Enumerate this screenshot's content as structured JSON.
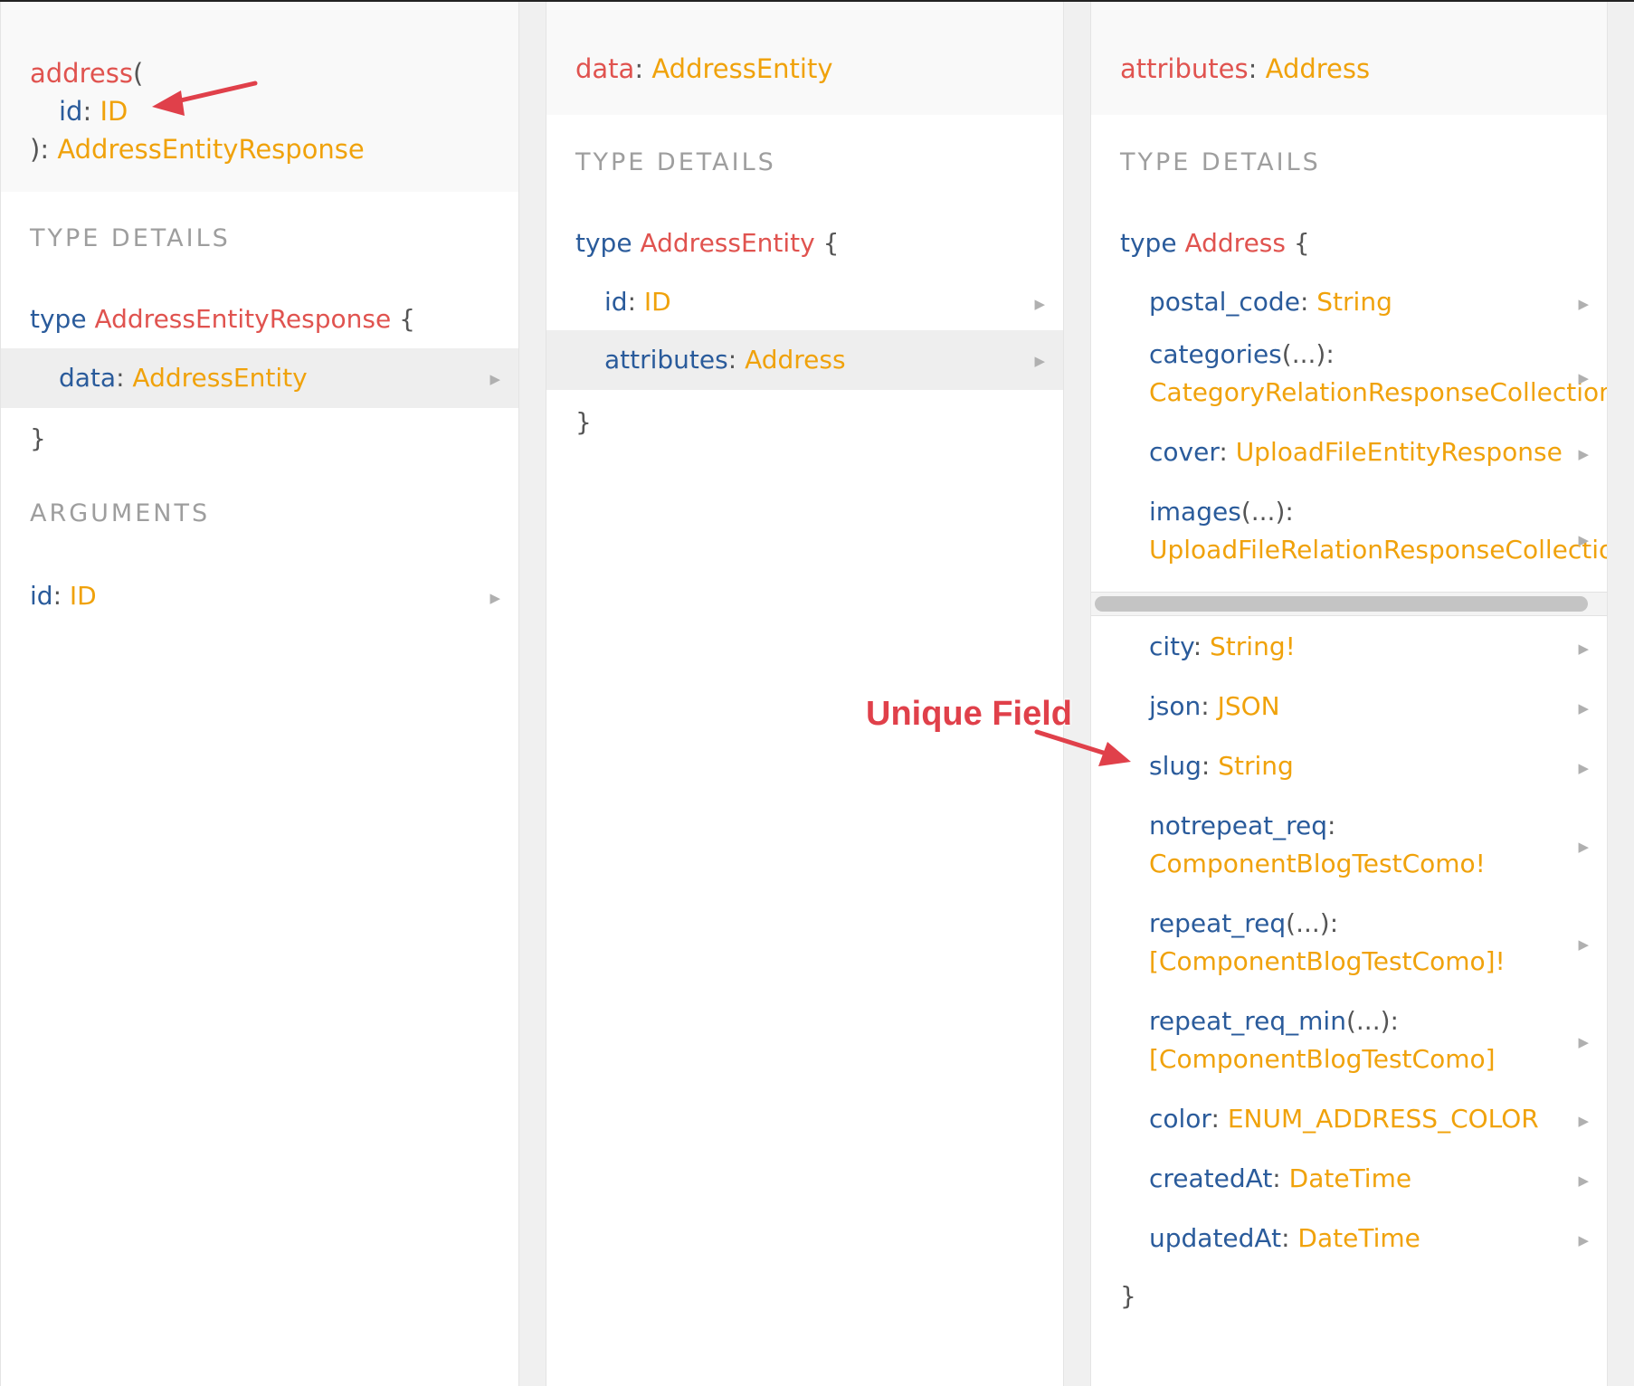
{
  "column1": {
    "header": {
      "name": "address",
      "open_paren": "(",
      "arg_name": "id",
      "arg_type": "ID",
      "close": "): ",
      "return_type": "AddressEntityResponse"
    },
    "type_details_title": "TYPE DETAILS",
    "type_keyword": "type",
    "type_name": "AddressEntityResponse",
    "open_brace": "{",
    "fields": [
      {
        "name": "data",
        "type": "AddressEntity"
      }
    ],
    "close_brace": "}",
    "arguments_title": "ARGUMENTS",
    "arguments": [
      {
        "name": "id",
        "type": "ID"
      }
    ]
  },
  "column2": {
    "header": {
      "name": "data",
      "type": "AddressEntity"
    },
    "type_details_title": "TYPE DETAILS",
    "type_keyword": "type",
    "type_name": "AddressEntity",
    "open_brace": "{",
    "fields": [
      {
        "name": "id",
        "type": "ID"
      },
      {
        "name": "attributes",
        "type": "Address"
      }
    ],
    "close_brace": "}"
  },
  "column3": {
    "header": {
      "name": "attributes",
      "type": "Address"
    },
    "type_details_title": "TYPE DETAILS",
    "type_keyword": "type",
    "type_name": "Address",
    "open_brace": "{",
    "fields": [
      {
        "name": "postal_code",
        "suffix": ": ",
        "type": "String"
      },
      {
        "name": "categories",
        "suffix": "(...):",
        "type": "CategoryRelationResponseCollection"
      },
      {
        "name": "cover",
        "suffix": ": ",
        "type": "UploadFileEntityResponse"
      },
      {
        "name": "images",
        "suffix": "(...):",
        "type": "UploadFileRelationResponseCollectio"
      },
      {
        "name": "city",
        "suffix": ": ",
        "type": "String!"
      },
      {
        "name": "json",
        "suffix": ": ",
        "type": "JSON"
      },
      {
        "name": "slug",
        "suffix": ": ",
        "type": "String"
      },
      {
        "name": "notrepeat_req",
        "suffix": ":",
        "type": "ComponentBlogTestComo!"
      },
      {
        "name": "repeat_req",
        "suffix": "(...):",
        "type": "[ComponentBlogTestComo]!"
      },
      {
        "name": "repeat_req_min",
        "suffix": "(...):",
        "type": "[ComponentBlogTestComo]"
      },
      {
        "name": "color",
        "suffix": ": ",
        "type": "ENUM_ADDRESS_COLOR"
      },
      {
        "name": "createdAt",
        "suffix": ": ",
        "type": "DateTime"
      },
      {
        "name": "updatedAt",
        "suffix": ": ",
        "type": "DateTime"
      }
    ],
    "close_brace": "}"
  },
  "annotation": {
    "label": "Unique Field"
  },
  "colors": {
    "function_name": "#e0534f",
    "type_name": "#f0a20b",
    "field_name": "#2a5b9b",
    "annotation": "#e0404a",
    "selected_row": "#eeeeee"
  },
  "icons": {
    "expand": "right-triangle-icon",
    "annotation_arrow": "red-arrow-icon"
  }
}
